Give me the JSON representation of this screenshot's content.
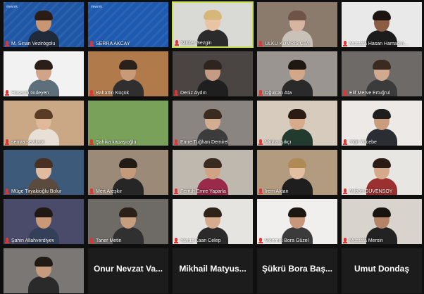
{
  "participants": [
    {
      "name": "M. Sinan Vezirögolu",
      "bg": "#1f57a6",
      "skin": "#c99573",
      "hair": "#2a1d16",
      "shirt": "#202a3b",
      "banner": true,
      "logo": "#ewmk"
    },
    {
      "name": "SERRA AKCAY",
      "bg": "#1e5ab0",
      "skin": "",
      "hair": "",
      "shirt": "",
      "banner": true,
      "logo": "#ewmk"
    },
    {
      "name": "Nilüfer Sezgin",
      "bg": "#d9d9d6",
      "skin": "#e8c4a4",
      "hair": "#d6b77a",
      "shirt": "#2b2b2b",
      "active": true
    },
    {
      "name": "ÜLKÜ KÜMRİŞ ÇTA",
      "bg": "#8a7b6d",
      "skin": "#d8b5a0",
      "hair": "#6e5446",
      "shirt": "#c9c2b8"
    },
    {
      "name": "Mustafa Hasan Hamad A...",
      "bg": "#e9e9e9",
      "skin": "#8b5d43",
      "hair": "#1b1410",
      "shirt": "#1c1c1c"
    },
    {
      "name": "Hüseyin Güleyen",
      "bg": "#f2f2f2",
      "skin": "#d2a487",
      "hair": "#2a1f18",
      "shirt": "#5c6f7a"
    },
    {
      "name": "Bahattin Küçük",
      "bg": "#b07a4a",
      "skin": "#c99a78",
      "hair": "#2a211a",
      "shirt": "#2f2f2f"
    },
    {
      "name": "Deniz Aydın",
      "bg": "#4a4543",
      "skin": "#c59b83",
      "hair": "#2f2520",
      "shirt": "#1f1f1f"
    },
    {
      "name": "Oğulcan Ata",
      "bg": "#9a9590",
      "skin": "#d2a889",
      "hair": "#1f1812",
      "shirt": "#2a2a2a"
    },
    {
      "name": "Elif Merve Ertuğrul",
      "bg": "#6d6a68",
      "skin": "#d1a98f",
      "hair": "#3a2a20",
      "shirt": "#3b3b3b"
    },
    {
      "name": "semra sevdiyol",
      "bg": "#caa886",
      "skin": "#e0b99b",
      "hair": "#5a3b26",
      "shirt": "#e8e0d6"
    },
    {
      "name": "Şahika kapaşıoğlu",
      "bg": "#7aa15a",
      "skin": "",
      "hair": "",
      "shirt": ""
    },
    {
      "name": "Emre Tuğhan Demirel",
      "bg": "#8a8580",
      "skin": "#d3ad92",
      "hair": "#3a2b21",
      "shirt": "#3c3c3c"
    },
    {
      "name": "Minha Işıkçı",
      "bg": "#d6cbbd",
      "skin": "#d6aa8b",
      "hair": "#2a1c14",
      "shirt": "#233b2e"
    },
    {
      "name": "Yiğit Yücebe",
      "bg": "#ece9e6",
      "skin": "#c99c7d",
      "hair": "#1e1e1e",
      "shirt": "#2a2e33"
    },
    {
      "name": "Müge Tiryakioğlu Bolur",
      "bg": "#3e5a7a",
      "skin": "#e1bba0",
      "hair": "#4a3022",
      "shirt": "#5b4a3e"
    },
    {
      "name": "Mert Ateşkır",
      "bg": "#9b8a78",
      "skin": "#c59a7b",
      "hair": "#221a14",
      "shirt": "#262626"
    },
    {
      "name": "Ferruh Emre Yaparla",
      "bg": "#bfb8ae",
      "skin": "#d0a385",
      "hair": "#3a2a1f",
      "shirt": "#9a2a4a"
    },
    {
      "name": "İrem Aktan",
      "bg": "#b39b80",
      "skin": "#e3bea0",
      "hair": "#b08a55",
      "shirt": "#1e1e1e"
    },
    {
      "name": "Nilgün GÜVENSOY",
      "bg": "#e8e6e2",
      "skin": "#d6a98b",
      "hair": "#2b1d15",
      "shirt": "#9b3030"
    },
    {
      "name": "Şahin Allahverdiyev",
      "bg": "#4a4a6a",
      "skin": "#c99877",
      "hair": "#221813",
      "shirt": "#34405a"
    },
    {
      "name": "Taner Metin",
      "bg": "#6e6a66",
      "skin": "#c79d80",
      "hair": "#2a2018",
      "shirt": "#303030"
    },
    {
      "name": "Yavuz Kaan Celep",
      "bg": "#e6e4e0",
      "skin": "#d6ab8d",
      "hair": "#2e2219",
      "shirt": "#2a2a2a"
    },
    {
      "name": "Mehmet Bora Güzel",
      "bg": "#f0efed",
      "skin": "#c8967a",
      "hair": "#1d1712",
      "shirt": "#3b3b3b"
    },
    {
      "name": "Mustafa Mersin",
      "bg": "#d8d3cc",
      "skin": "#b58466",
      "hair": "#1a1411",
      "shirt": "#222222"
    },
    {
      "name": "",
      "bg": "#7a7775",
      "skin": "#c59a7d",
      "hair": "#221a14",
      "shirt": "#2a2a2a"
    },
    {
      "name": "",
      "big": "Onur Nevzat Va...",
      "bg": "#1c1c1c"
    },
    {
      "name": "",
      "big": "Mikhail Matyus...",
      "bg": "#1c1c1c"
    },
    {
      "name": "",
      "big": "Şükrü Bora Baş...",
      "bg": "#1c1c1c"
    },
    {
      "name": "",
      "big": "Umut Dondaş",
      "bg": "#1c1c1c"
    }
  ]
}
